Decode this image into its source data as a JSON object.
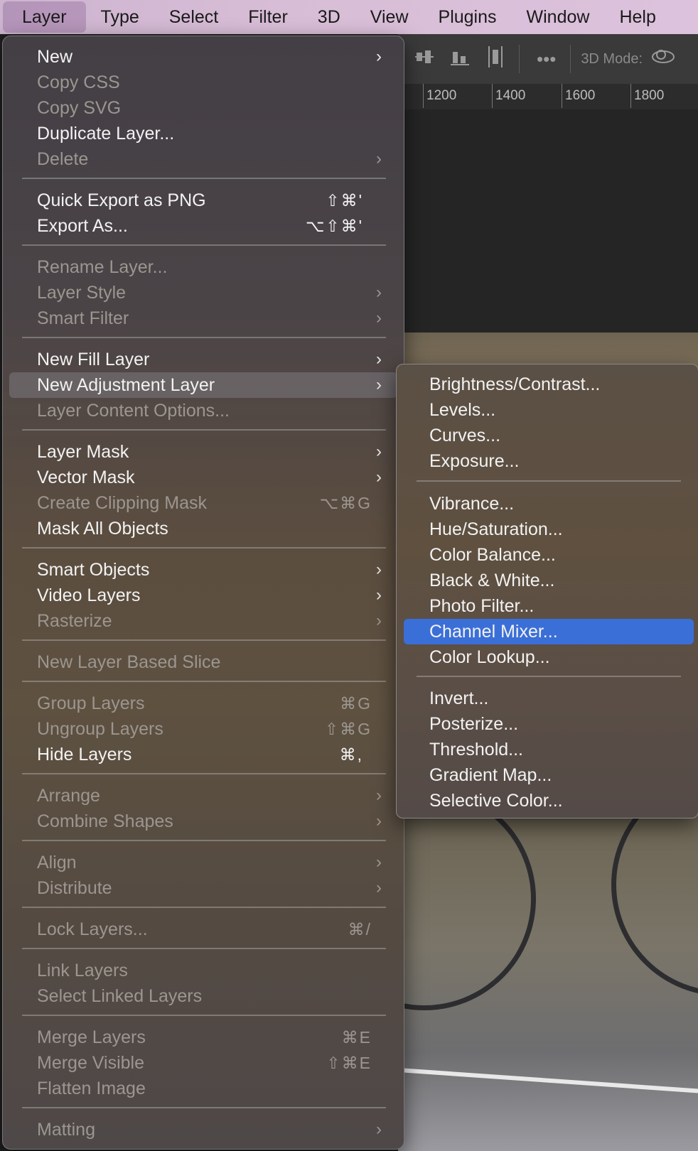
{
  "menubar": {
    "items": [
      "Layer",
      "Type",
      "Select",
      "Filter",
      "3D",
      "View",
      "Plugins",
      "Window",
      "Help"
    ]
  },
  "toolbar": {
    "mode_label": "3D Mode:"
  },
  "ruler": {
    "ticks": [
      "1200",
      "1400",
      "1600",
      "1800"
    ]
  },
  "layer_menu": {
    "items": [
      {
        "label": "New",
        "arrow": true
      },
      {
        "label": "Copy CSS",
        "disabled": true
      },
      {
        "label": "Copy SVG",
        "disabled": true
      },
      {
        "label": "Duplicate Layer..."
      },
      {
        "label": "Delete",
        "disabled": true,
        "arrow": true
      },
      {
        "label": "Quick Export as PNG",
        "shortcut": "⇧⌘'"
      },
      {
        "label": "Export As...",
        "shortcut": "⌥⇧⌘'"
      },
      {
        "label": "Rename Layer...",
        "disabled": true
      },
      {
        "label": "Layer Style",
        "disabled": true,
        "arrow": true
      },
      {
        "label": "Smart Filter",
        "disabled": true,
        "arrow": true
      },
      {
        "label": "New Fill Layer",
        "arrow": true
      },
      {
        "label": "New Adjustment Layer",
        "arrow": true,
        "highlighted": true
      },
      {
        "label": "Layer Content Options...",
        "disabled": true
      },
      {
        "label": "Layer Mask",
        "arrow": true
      },
      {
        "label": "Vector Mask",
        "arrow": true
      },
      {
        "label": "Create Clipping Mask",
        "disabled": true,
        "shortcut": "⌥⌘G"
      },
      {
        "label": "Mask All Objects"
      },
      {
        "label": "Smart Objects",
        "arrow": true
      },
      {
        "label": "Video Layers",
        "arrow": true
      },
      {
        "label": "Rasterize",
        "disabled": true,
        "arrow": true
      },
      {
        "label": "New Layer Based Slice",
        "disabled": true
      },
      {
        "label": "Group Layers",
        "disabled": true,
        "shortcut": "⌘G"
      },
      {
        "label": "Ungroup Layers",
        "disabled": true,
        "shortcut": "⇧⌘G"
      },
      {
        "label": "Hide Layers",
        "shortcut": "⌘,"
      },
      {
        "label": "Arrange",
        "disabled": true,
        "arrow": true
      },
      {
        "label": "Combine Shapes",
        "disabled": true,
        "arrow": true
      },
      {
        "label": "Align",
        "disabled": true,
        "arrow": true
      },
      {
        "label": "Distribute",
        "disabled": true,
        "arrow": true
      },
      {
        "label": "Lock Layers...",
        "disabled": true,
        "shortcut": "⌘/"
      },
      {
        "label": "Link Layers",
        "disabled": true
      },
      {
        "label": "Select Linked Layers",
        "disabled": true
      },
      {
        "label": "Merge Layers",
        "disabled": true,
        "shortcut": "⌘E"
      },
      {
        "label": "Merge Visible",
        "disabled": true,
        "shortcut": "⇧⌘E"
      },
      {
        "label": "Flatten Image",
        "disabled": true
      },
      {
        "label": "Matting",
        "disabled": true,
        "arrow": true
      }
    ]
  },
  "adjustment_submenu": {
    "items": [
      {
        "label": "Brightness/Contrast..."
      },
      {
        "label": "Levels..."
      },
      {
        "label": "Curves..."
      },
      {
        "label": "Exposure..."
      },
      {
        "label": "Vibrance..."
      },
      {
        "label": "Hue/Saturation..."
      },
      {
        "label": "Color Balance..."
      },
      {
        "label": "Black & White..."
      },
      {
        "label": "Photo Filter..."
      },
      {
        "label": "Channel Mixer...",
        "selected": true
      },
      {
        "label": "Color Lookup..."
      },
      {
        "label": "Invert..."
      },
      {
        "label": "Posterize..."
      },
      {
        "label": "Threshold..."
      },
      {
        "label": "Gradient Map..."
      },
      {
        "label": "Selective Color..."
      }
    ]
  },
  "icons": {
    "submenu_arrow": "chevron-right-icon",
    "toolbar": [
      "align-center-icon",
      "align-bottom-icon",
      "distribute-icon",
      "more-icon",
      "orbit-3d-icon"
    ]
  },
  "colors": {
    "selection": "#3b6fd8",
    "menubar": "#d8bdd6"
  }
}
